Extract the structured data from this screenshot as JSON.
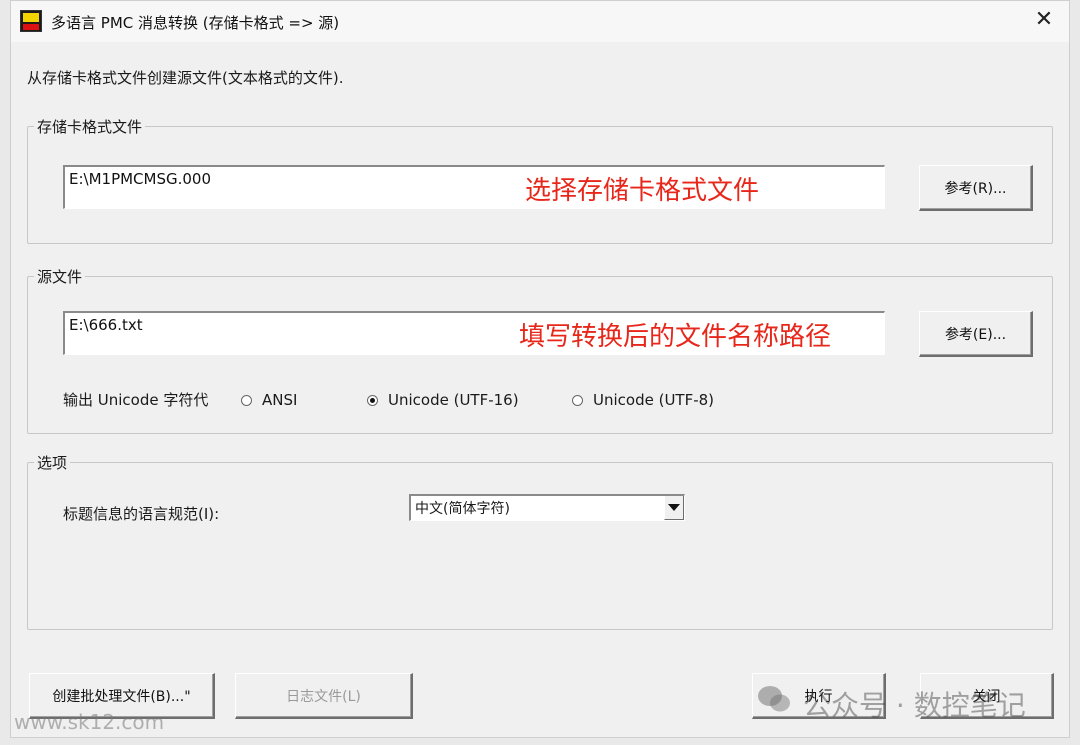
{
  "window": {
    "title": "多语言 PMC 消息转换 (存储卡格式 => 源)",
    "description": "从存储卡格式文件创建源文件(文本格式的文件)."
  },
  "memory_card_group": {
    "legend": "存储卡格式文件",
    "path_value": "E:\\M1PMCMSG.000",
    "annotation": "选择存储卡格式文件",
    "browse_label": "参考(R)..."
  },
  "source_group": {
    "legend": "源文件",
    "path_value": "E:\\666.txt",
    "annotation": "填写转换后的文件名称路径",
    "browse_label": "参考(E)...",
    "encoding_label": "输出 Unicode 字符代",
    "encoding_options": [
      "ANSI",
      "Unicode (UTF-16)",
      "Unicode (UTF-8)"
    ],
    "encoding_selected": "Unicode (UTF-16)"
  },
  "options_group": {
    "legend": "选项",
    "language_label": "标题信息的语言规范(I):",
    "language_selected": "中文(简体字符)"
  },
  "footer": {
    "batch_button": "创建批处理文件(B)...\"",
    "log_button": "日志文件(L)",
    "execute_button": "执行",
    "close_button": "关闭"
  },
  "watermark": {
    "text": "公众号 · 数控笔记",
    "url": "www.sk12.com"
  },
  "colors": {
    "annotation": "#e8271b",
    "window_bg": "#f0f0f0"
  }
}
